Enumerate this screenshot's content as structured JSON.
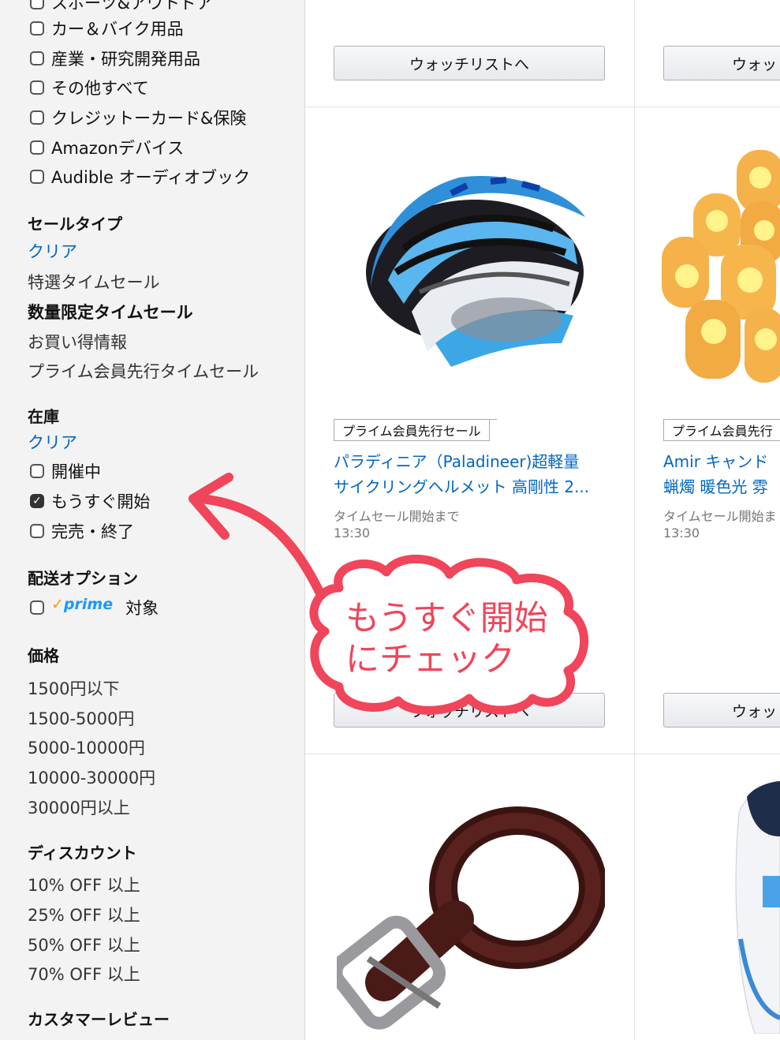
{
  "filters": {
    "category_items": [
      {
        "label": "スポーツ&アウトドア"
      },
      {
        "label": "カー＆バイク用品"
      },
      {
        "label": "産業・研究開発用品"
      },
      {
        "label": "その他すべて"
      },
      {
        "label": "クレジットーカード&保険"
      },
      {
        "label": "Amazonデバイス"
      },
      {
        "label": "Audible オーディオブック"
      }
    ],
    "sale_type": {
      "heading": "セールタイプ",
      "clear": "クリア",
      "options": [
        "特選タイムセール",
        "数量限定タイムセール",
        "お買い得情報",
        "プライム会員先行タイムセール"
      ],
      "selected": "数量限定タイムセール"
    },
    "stock": {
      "heading": "在庫",
      "clear": "クリア",
      "options": [
        {
          "label": "開催中",
          "checked": false
        },
        {
          "label": "もうすぐ開始",
          "checked": true
        },
        {
          "label": "完売・終了",
          "checked": false
        }
      ]
    },
    "shipping": {
      "heading": "配送オプション",
      "prime_logo": "prime",
      "label": "対象"
    },
    "price": {
      "heading": "価格",
      "options": [
        "1500円以下",
        "1500-5000円",
        "5000-10000円",
        "10000-30000円",
        "30000円以上"
      ]
    },
    "discount": {
      "heading": "ディスカウント",
      "options": [
        "10% OFF 以上",
        "25% OFF 以上",
        "50% OFF 以上",
        "70% OFF 以上"
      ]
    },
    "reviews": {
      "heading": "カスタマーレビュー"
    }
  },
  "products": {
    "watchlist_label": "ウォッチリストへ",
    "watchlist_label_truncated": "ウォッ",
    "items": [
      {
        "badge": "プライム会員先行セール",
        "title_line1": "パラディニア（Paladineer)超軽量",
        "title_line2": "サイクリングヘルメット 高剛性 2...",
        "status": "タイムセール開始まで",
        "time": "13:30"
      },
      {
        "badge": "プライム会員先行",
        "title_line1": "Amir キャンド",
        "title_line2": "蝋燭 暖色光 雰",
        "status": "タイムセール開始ま",
        "time": "13:30"
      }
    ]
  },
  "annotation": {
    "line1": "もうすぐ開始",
    "line2": "にチェック",
    "color": "#f0455a"
  }
}
